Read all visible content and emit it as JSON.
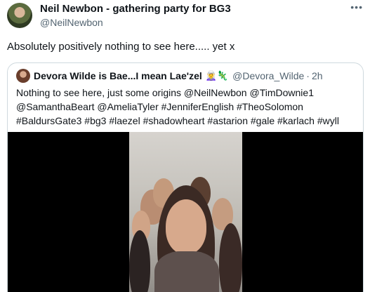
{
  "author": {
    "display_name": "Neil Newbon - gathering party for BG3",
    "handle": "@NeilNewbon",
    "avatar": "avatar-photo"
  },
  "more_icon": "ellipsis-icon",
  "tweet_text": "Absolutely positively nothing to see here..... yet x",
  "quote": {
    "display_name": "Devora Wilde is Bae...I mean Lae'zel",
    "emojis": "🧝‍♀️🦎",
    "handle": "@Devora_Wilde",
    "separator": "·",
    "time": "2h",
    "text_lines": [
      "Nothing to see here, just some origins @NeilNewbon @TimDownie1",
      "@SamanthaBeart @AmeliaTyler #JenniferEnglish #TheoSolomon",
      "#BaldursGate3 #bg3 #laezel #shadowheart #astarion #gale #karlach #wyll"
    ],
    "media": "video-thumbnail"
  }
}
